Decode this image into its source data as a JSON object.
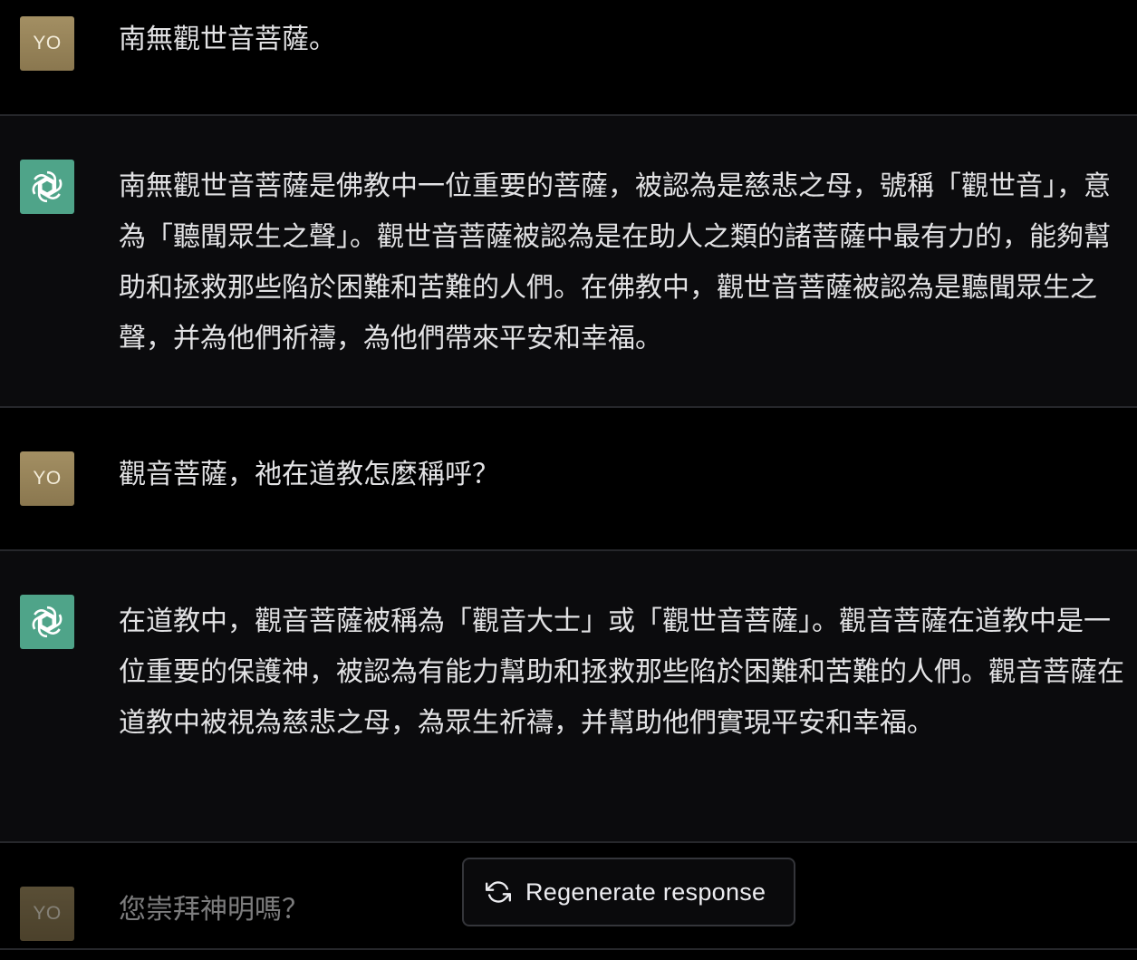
{
  "messages": [
    {
      "role": "user",
      "avatar_text": "YO",
      "text": "南無觀世音菩薩。"
    },
    {
      "role": "assistant",
      "avatar_icon": "openai-logo-icon",
      "text": "南無觀世音菩薩是佛教中一位重要的菩薩，被認為是慈悲之母，號稱「觀世音」，意為「聽聞眾生之聲」。觀世音菩薩被認為是在助人之類的諸菩薩中最有力的，能夠幫助和拯救那些陷於困難和苦難的人們。在佛教中，觀世音菩薩被認為是聽聞眾生之聲，并為他們祈禱，為他們帶來平安和幸福。"
    },
    {
      "role": "user",
      "avatar_text": "YO",
      "text": "觀音菩薩，祂在道教怎麼稱呼？"
    },
    {
      "role": "assistant",
      "avatar_icon": "openai-logo-icon",
      "text": "在道教中，觀音菩薩被稱為「觀音大士」或「觀世音菩薩」。觀音菩薩在道教中是一位重要的保護神，被認為有能力幫助和拯救那些陷於困難和苦難的人們。觀音菩薩在道教中被視為慈悲之母，為眾生祈禱，并幫助他們實現平安和幸福。"
    },
    {
      "role": "user",
      "avatar_text": "YO",
      "text": "您崇拜神明嗎？"
    }
  ],
  "regenerate": {
    "label": "Regenerate response",
    "icon": "refresh-icon"
  },
  "colors": {
    "user_avatar": "#9a8659",
    "bot_avatar": "#4fa489",
    "background": "#000000",
    "assistant_row": "#0b0b0d"
  }
}
